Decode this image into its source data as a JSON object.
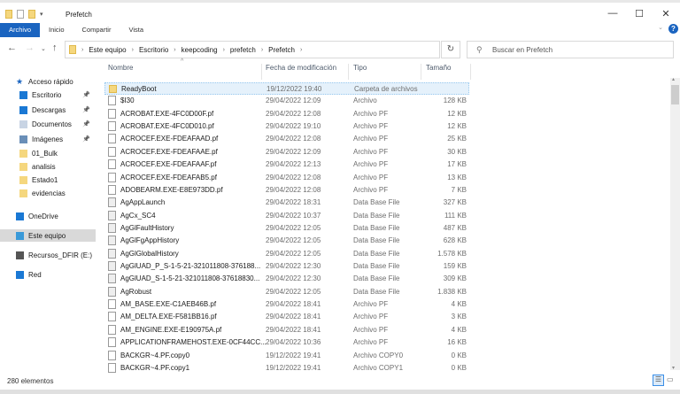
{
  "window": {
    "title": "Prefetch",
    "minimize": "—",
    "maximize": "☐",
    "close": "✕",
    "help": "?"
  },
  "ribbon": {
    "tabs": [
      "Archivo",
      "Inicio",
      "Compartir",
      "Vista"
    ]
  },
  "address": {
    "crumbs": [
      "Este equipo",
      "Escritorio",
      "keepcoding",
      "prefetch",
      "Prefetch"
    ]
  },
  "search": {
    "placeholder": "Buscar en Prefetch"
  },
  "columns": {
    "name": "Nombre",
    "date": "Fecha de modificación",
    "type": "Tipo",
    "size": "Tamaño"
  },
  "sidebar": {
    "items": [
      {
        "label": "Acceso rápido",
        "icon": "star-icon",
        "color": "#1a64c0",
        "pin": false
      },
      {
        "label": "Escritorio",
        "icon": "desktop-icon",
        "color": "#1a78d4",
        "pin": true
      },
      {
        "label": "Descargas",
        "icon": "download-icon",
        "color": "#1a78d4",
        "pin": true
      },
      {
        "label": "Documentos",
        "icon": "document-icon",
        "color": "#c8d4e4",
        "pin": true
      },
      {
        "label": "Imágenes",
        "icon": "image-icon",
        "color": "#6a8fb8",
        "pin": true
      },
      {
        "label": "01_Bulk",
        "icon": "folder-icon",
        "color": "#f5d77e",
        "pin": false
      },
      {
        "label": "analisis",
        "icon": "folder-icon",
        "color": "#f5d77e",
        "pin": false
      },
      {
        "label": "Estado1",
        "icon": "folder-icon",
        "color": "#f5d77e",
        "pin": false
      },
      {
        "label": "evidencias",
        "icon": "folder-icon",
        "color": "#f5d77e",
        "pin": false
      },
      {
        "label": "OneDrive",
        "icon": "cloud-icon",
        "color": "#1a78d4",
        "pin": false
      },
      {
        "label": "Este equipo",
        "icon": "computer-icon",
        "color": "#3a9ad9",
        "pin": false,
        "selected": true
      },
      {
        "label": "Recursos_DFIR (E:)",
        "icon": "drive-icon",
        "color": "#555555",
        "pin": false
      },
      {
        "label": "Red",
        "icon": "network-icon",
        "color": "#1a78d4",
        "pin": false
      }
    ]
  },
  "files": [
    {
      "name": "ReadyBoot",
      "date": "19/12/2022 19:40",
      "type": "Carpeta de archivos",
      "size": "",
      "kind": "folder"
    },
    {
      "name": "$I30",
      "date": "29/04/2022 12:09",
      "type": "Archivo",
      "size": "128 KB",
      "kind": "file"
    },
    {
      "name": "ACROBAT.EXE-4FC0D00F.pf",
      "date": "29/04/2022 12:08",
      "type": "Archivo PF",
      "size": "12 KB",
      "kind": "file"
    },
    {
      "name": "ACROBAT.EXE-4FC0D010.pf",
      "date": "29/04/2022 19:10",
      "type": "Archivo PF",
      "size": "12 KB",
      "kind": "file"
    },
    {
      "name": "ACROCEF.EXE-FDEAFAAD.pf",
      "date": "29/04/2022 12:08",
      "type": "Archivo PF",
      "size": "25 KB",
      "kind": "file"
    },
    {
      "name": "ACROCEF.EXE-FDEAFAAE.pf",
      "date": "29/04/2022 12:09",
      "type": "Archivo PF",
      "size": "30 KB",
      "kind": "file"
    },
    {
      "name": "ACROCEF.EXE-FDEAFAAF.pf",
      "date": "29/04/2022 12:13",
      "type": "Archivo PF",
      "size": "17 KB",
      "kind": "file"
    },
    {
      "name": "ACROCEF.EXE-FDEAFAB5.pf",
      "date": "29/04/2022 12:08",
      "type": "Archivo PF",
      "size": "13 KB",
      "kind": "file"
    },
    {
      "name": "ADOBEARM.EXE-E8E973DD.pf",
      "date": "29/04/2022 12:08",
      "type": "Archivo PF",
      "size": "7 KB",
      "kind": "file"
    },
    {
      "name": "AgAppLaunch",
      "date": "29/04/2022 18:31",
      "type": "Data Base File",
      "size": "327 KB",
      "kind": "db"
    },
    {
      "name": "AgCx_SC4",
      "date": "29/04/2022 10:37",
      "type": "Data Base File",
      "size": "111 KB",
      "kind": "db"
    },
    {
      "name": "AgGlFaultHistory",
      "date": "29/04/2022 12:05",
      "type": "Data Base File",
      "size": "487 KB",
      "kind": "db"
    },
    {
      "name": "AgGlFgAppHistory",
      "date": "29/04/2022 12:05",
      "type": "Data Base File",
      "size": "628 KB",
      "kind": "db"
    },
    {
      "name": "AgGlGlobalHistory",
      "date": "29/04/2022 12:05",
      "type": "Data Base File",
      "size": "1.578 KB",
      "kind": "db"
    },
    {
      "name": "AgGlUAD_P_S-1-5-21-321011808-376188...",
      "date": "29/04/2022 12:30",
      "type": "Data Base File",
      "size": "159 KB",
      "kind": "db"
    },
    {
      "name": "AgGlUAD_S-1-5-21-321011808-37618830...",
      "date": "29/04/2022 12:30",
      "type": "Data Base File",
      "size": "309 KB",
      "kind": "db"
    },
    {
      "name": "AgRobust",
      "date": "29/04/2022 12:05",
      "type": "Data Base File",
      "size": "1.838 KB",
      "kind": "db"
    },
    {
      "name": "AM_BASE.EXE-C1AEB46B.pf",
      "date": "29/04/2022 18:41",
      "type": "Archivo PF",
      "size": "4 KB",
      "kind": "file"
    },
    {
      "name": "AM_DELTA.EXE-F581BB16.pf",
      "date": "29/04/2022 18:41",
      "type": "Archivo PF",
      "size": "3 KB",
      "kind": "file"
    },
    {
      "name": "AM_ENGINE.EXE-E190975A.pf",
      "date": "29/04/2022 18:41",
      "type": "Archivo PF",
      "size": "4 KB",
      "kind": "file"
    },
    {
      "name": "APPLICATIONFRAMEHOST.EXE-0CF44CC...",
      "date": "29/04/2022 10:36",
      "type": "Archivo PF",
      "size": "16 KB",
      "kind": "file"
    },
    {
      "name": "BACKGR~4.PF.copy0",
      "date": "19/12/2022 19:41",
      "type": "Archivo COPY0",
      "size": "0 KB",
      "kind": "file"
    },
    {
      "name": "BACKGR~4.PF.copy1",
      "date": "19/12/2022 19:41",
      "type": "Archivo COPY1",
      "size": "0 KB",
      "kind": "file"
    }
  ],
  "status": {
    "count": "280 elementos"
  }
}
